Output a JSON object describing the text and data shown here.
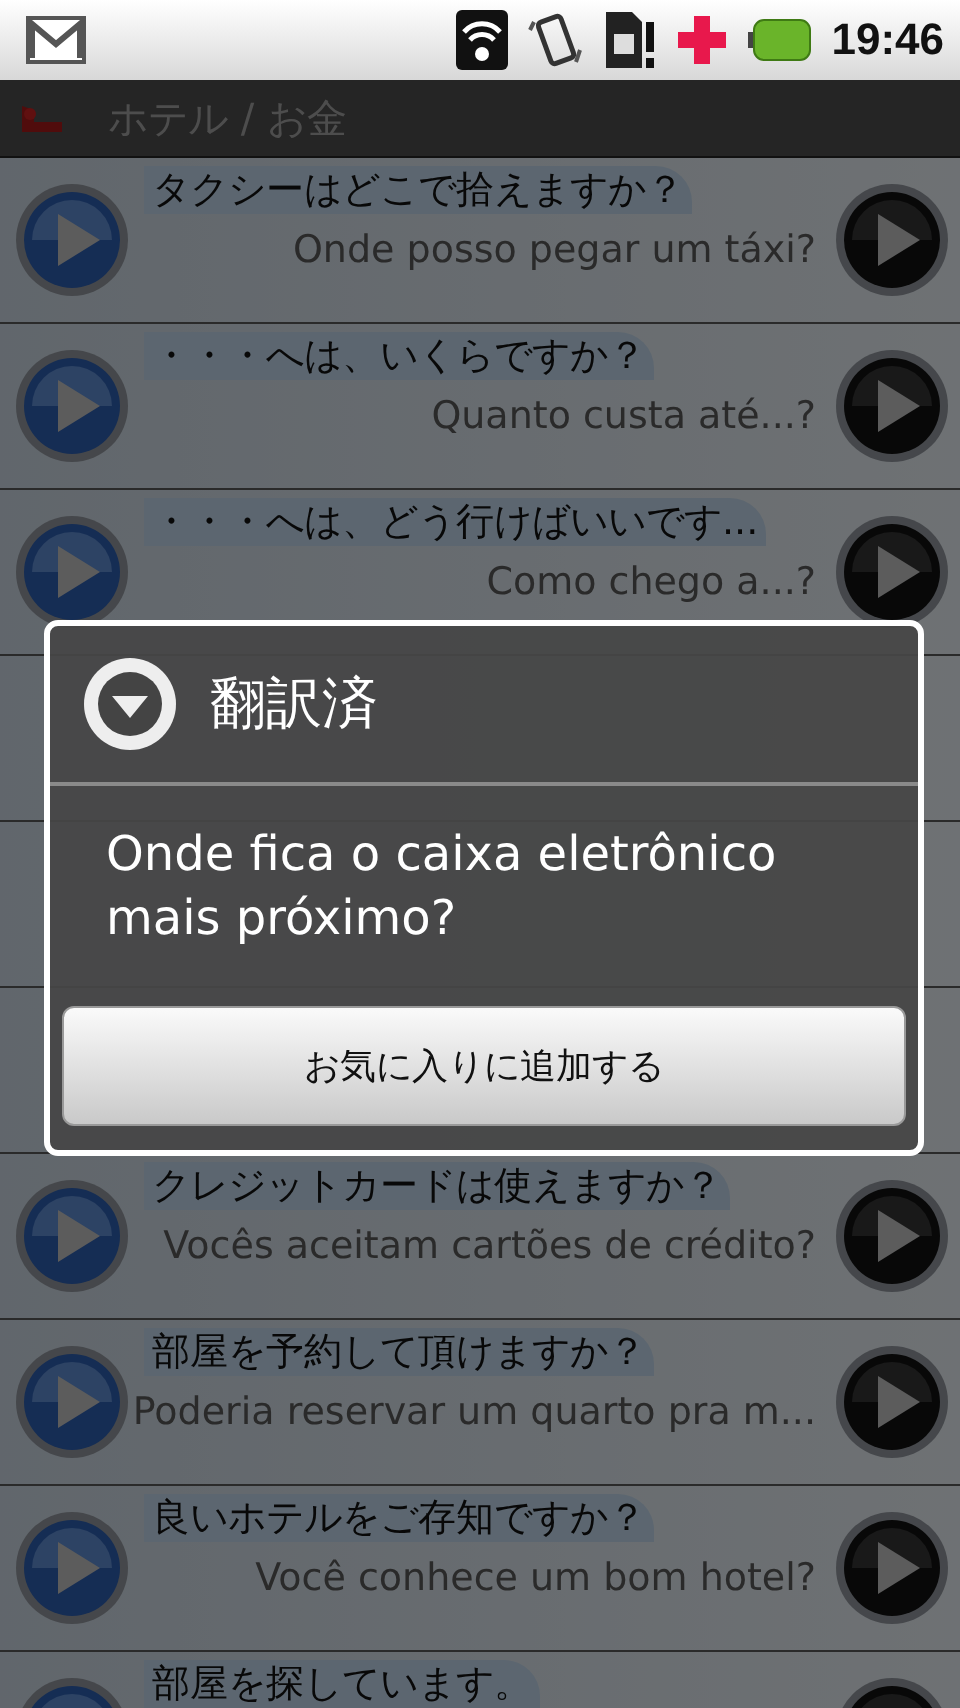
{
  "status_bar": {
    "time": "19:46"
  },
  "header": {
    "title": "ホテル / お金"
  },
  "phrases": [
    {
      "kind": "phrase",
      "japanese": "タクシーはどこで拾えますか？",
      "portuguese": "Onde posso pegar um táxi?"
    },
    {
      "kind": "phrase",
      "japanese": "・・・へは、いくらですか？",
      "portuguese": "Quanto custa até...?"
    },
    {
      "kind": "phrase",
      "japanese": "・・・へは、どう行けばいいです...",
      "portuguese": "Como chego a...?"
    },
    {
      "kind": "covered"
    },
    {
      "kind": "covered"
    },
    {
      "kind": "covered"
    },
    {
      "kind": "phrase",
      "japanese": "クレジットカードは使えますか？",
      "portuguese": "Vocês aceitam cartões de crédito?"
    },
    {
      "kind": "phrase",
      "japanese": "部屋を予約して頂けますか？",
      "portuguese": "Poderia reservar um quarto pra m..."
    },
    {
      "kind": "phrase",
      "japanese": "良いホテルをご存知ですか？",
      "portuguese": "Você conhece um bom hotel?"
    },
    {
      "kind": "phrase",
      "japanese": "部屋を探しています。"
    }
  ],
  "dialog": {
    "title": "翻訳済",
    "message": "Onde fica o caixa eletrônico mais próximo?",
    "button": "お気に入りに追加する"
  }
}
